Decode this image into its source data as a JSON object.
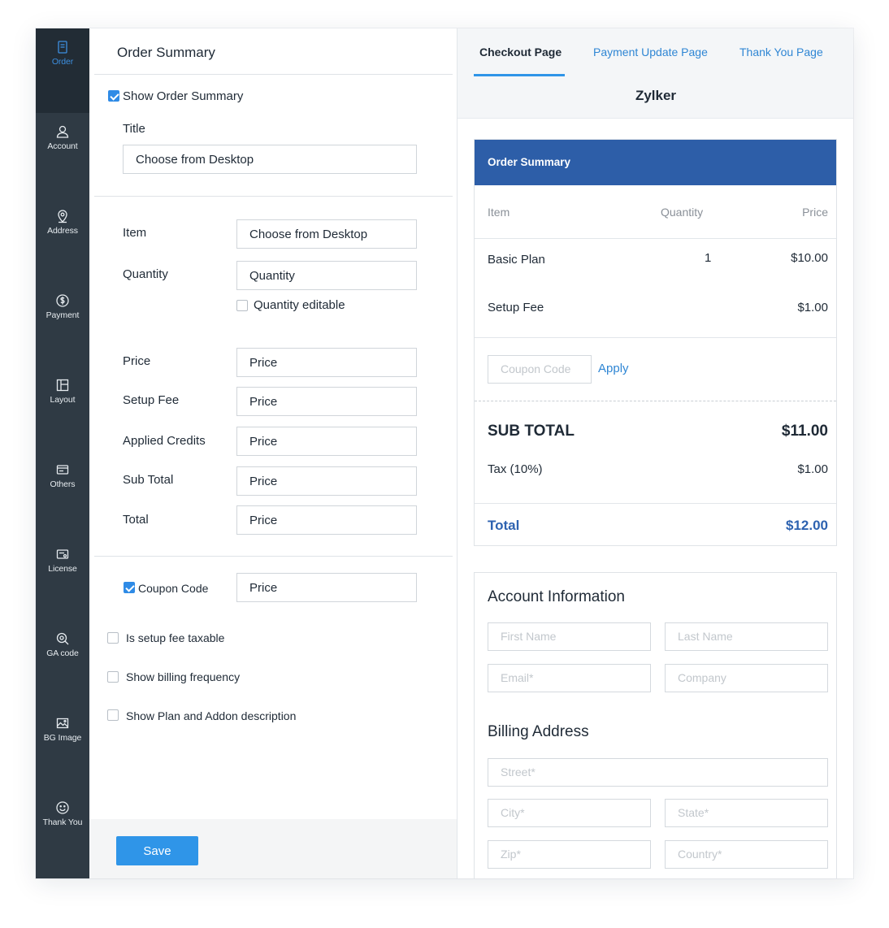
{
  "sidebar": {
    "items": [
      {
        "label": "Order",
        "icon": "order-icon"
      },
      {
        "label": "Account",
        "icon": "account-icon"
      },
      {
        "label": "Address",
        "icon": "location-pin-icon"
      },
      {
        "label": "Payment",
        "icon": "dollar-icon"
      },
      {
        "label": "Layout",
        "icon": "layout-icon"
      },
      {
        "label": "Others",
        "icon": "others-icon"
      },
      {
        "label": "License",
        "icon": "license-icon"
      },
      {
        "label": "GA code",
        "icon": "ga-code-icon"
      },
      {
        "label": "BG Image",
        "icon": "image-icon"
      },
      {
        "label": "Thank You",
        "icon": "smiley-icon"
      }
    ]
  },
  "settings": {
    "title": "Order Summary",
    "show_order_summary": {
      "label": "Show Order Summary",
      "checked": true
    },
    "title_field": {
      "label": "Title",
      "value": "Choose from Desktop"
    },
    "item": {
      "label": "Item",
      "value": "Choose from Desktop"
    },
    "quantity": {
      "label": "Quantity",
      "value": "Quantity"
    },
    "quantity_editable": {
      "label": "Quantity editable",
      "checked": false
    },
    "price": {
      "label": "Price",
      "value": "Price"
    },
    "setup_fee": {
      "label": "Setup Fee",
      "value": "Price"
    },
    "applied_credits": {
      "label": "Applied Credits",
      "value": "Price"
    },
    "sub_total": {
      "label": "Sub Total",
      "value": "Price"
    },
    "total": {
      "label": "Total",
      "value": "Price"
    },
    "coupon_code": {
      "label": "Coupon Code",
      "value": "Price",
      "checked": true
    },
    "setup_fee_taxable": {
      "label": "Is setup fee taxable",
      "checked": false
    },
    "show_billing_frequency": {
      "label": "Show billing frequency",
      "checked": false
    },
    "show_plan_addon_desc": {
      "label": "Show Plan and Addon description",
      "checked": false
    },
    "save_label": "Save"
  },
  "preview": {
    "tabs": [
      {
        "label": "Checkout Page",
        "active": true
      },
      {
        "label": "Payment Update Page",
        "active": false
      },
      {
        "label": "Thank You Page",
        "active": false
      }
    ],
    "brand": "Zylker",
    "order_summary": {
      "header": "Order Summary",
      "columns": {
        "item": "Item",
        "quantity": "Quantity",
        "price": "Price"
      },
      "rows": [
        {
          "item": "Basic Plan",
          "quantity": "1",
          "price": "$10.00"
        },
        {
          "item": "Setup Fee",
          "quantity": "",
          "price": "$1.00"
        }
      ],
      "coupon_placeholder": "Coupon Code",
      "apply_label": "Apply",
      "sub_total_label": "SUB TOTAL",
      "sub_total_value": "$11.00",
      "tax_label": "Tax (10%)",
      "tax_value": "$1.00",
      "total_label": "Total",
      "total_value": "$12.00"
    },
    "account_info": {
      "title": "Account Information",
      "first_name": "First Name",
      "last_name": "Last Name",
      "email": "Email*",
      "company": "Company"
    },
    "billing_address": {
      "title": "Billing Address",
      "street": "Street*",
      "city": "City*",
      "state": "State*",
      "zip": "Zip*",
      "country": "Country*"
    }
  },
  "colors": {
    "sidebar_bg": "#2f3a44",
    "accent": "#2f95e8",
    "summary_header": "#2d5ea8",
    "link": "#2f86d4"
  }
}
